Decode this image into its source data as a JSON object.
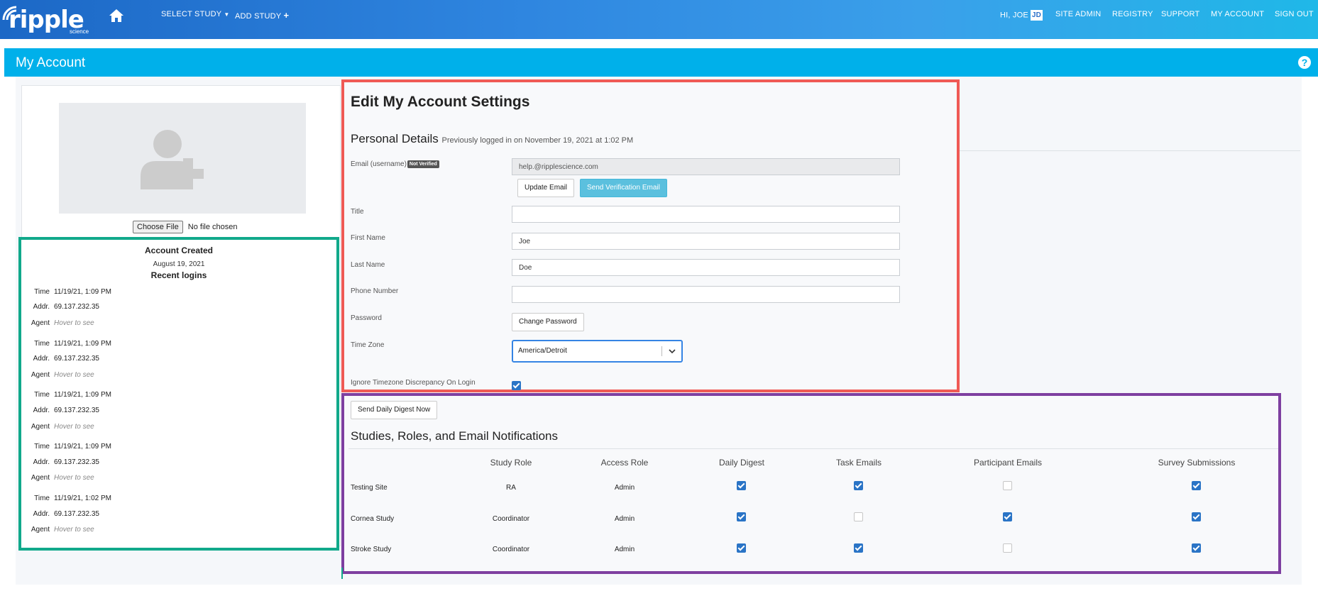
{
  "brand": {
    "name": "ripple",
    "sub": "science"
  },
  "nav": {
    "select_study": "SELECT STUDY",
    "add_study": "ADD STUDY",
    "greeting": "HI, JOE",
    "initials": "JD",
    "site_admin": "SITE ADMIN",
    "registry": "REGISTRY",
    "support": "SUPPORT",
    "my_account": "MY ACCOUNT",
    "sign_out": "SIGN OUT"
  },
  "page": {
    "title": "My Account",
    "help": "?"
  },
  "profile": {
    "choose_file": "Choose File",
    "no_file": "No file chosen",
    "account_created_label": "Account Created",
    "account_created_date": "August 19, 2021",
    "recent_logins_label": "Recent logins",
    "logins": [
      {
        "time": "11/19/21, 1:09 PM",
        "addr": "69.137.232.35",
        "agent": "Hover to see"
      },
      {
        "time": "11/19/21, 1:09 PM",
        "addr": "69.137.232.35",
        "agent": "Hover to see"
      },
      {
        "time": "11/19/21, 1:09 PM",
        "addr": "69.137.232.35",
        "agent": "Hover to see"
      },
      {
        "time": "11/19/21, 1:09 PM",
        "addr": "69.137.232.35",
        "agent": "Hover to see"
      },
      {
        "time": "11/19/21, 1:02 PM",
        "addr": "69.137.232.35",
        "agent": "Hover to see"
      }
    ],
    "labels": {
      "time": "Time",
      "addr": "Addr.",
      "agent": "Agent"
    }
  },
  "settings": {
    "title": "Edit My Account Settings",
    "personal_details": "Personal Details",
    "previous_login": "Previously logged in on November 19, 2021 at 1:02 PM",
    "email_label": "Email (username)",
    "not_verified": "Not Verified",
    "email_value": "help.@ripplescience.com",
    "update_email": "Update Email",
    "send_verification": "Send Verification Email",
    "title_label": "Title",
    "title_value": "",
    "first_name_label": "First Name",
    "first_name_value": "Joe",
    "last_name_label": "Last Name",
    "last_name_value": "Doe",
    "phone_label": "Phone Number",
    "phone_value": "",
    "password_label": "Password",
    "change_password": "Change Password",
    "timezone_label": "Time Zone",
    "timezone_value": "America/Detroit",
    "ignore_tz_label": "Ignore Timezone Discrepancy On Login",
    "ignore_tz_checked": true
  },
  "studies": {
    "send_digest": "Send Daily Digest Now",
    "title": "Studies, Roles, and Email Notifications",
    "columns": [
      "Study Role",
      "Access Role",
      "Daily Digest",
      "Task Emails",
      "Participant Emails",
      "Survey Submissions"
    ],
    "rows": [
      {
        "name": "Testing Site",
        "study_role": "RA",
        "access_role": "Admin",
        "daily_digest": true,
        "task_emails": true,
        "participant_emails": false,
        "survey_submissions": true
      },
      {
        "name": "Cornea Study",
        "study_role": "Coordinator",
        "access_role": "Admin",
        "daily_digest": true,
        "task_emails": false,
        "participant_emails": true,
        "survey_submissions": true
      },
      {
        "name": "Stroke Study",
        "study_role": "Coordinator",
        "access_role": "Admin",
        "daily_digest": true,
        "task_emails": true,
        "participant_emails": false,
        "survey_submissions": true
      }
    ]
  },
  "colors": {
    "nav_start": "#1c68c6",
    "nav_end": "#1fb8e8",
    "banner": "#00b0ea",
    "checkbox": "#2a74c6",
    "verify_button": "#5bc0de"
  }
}
